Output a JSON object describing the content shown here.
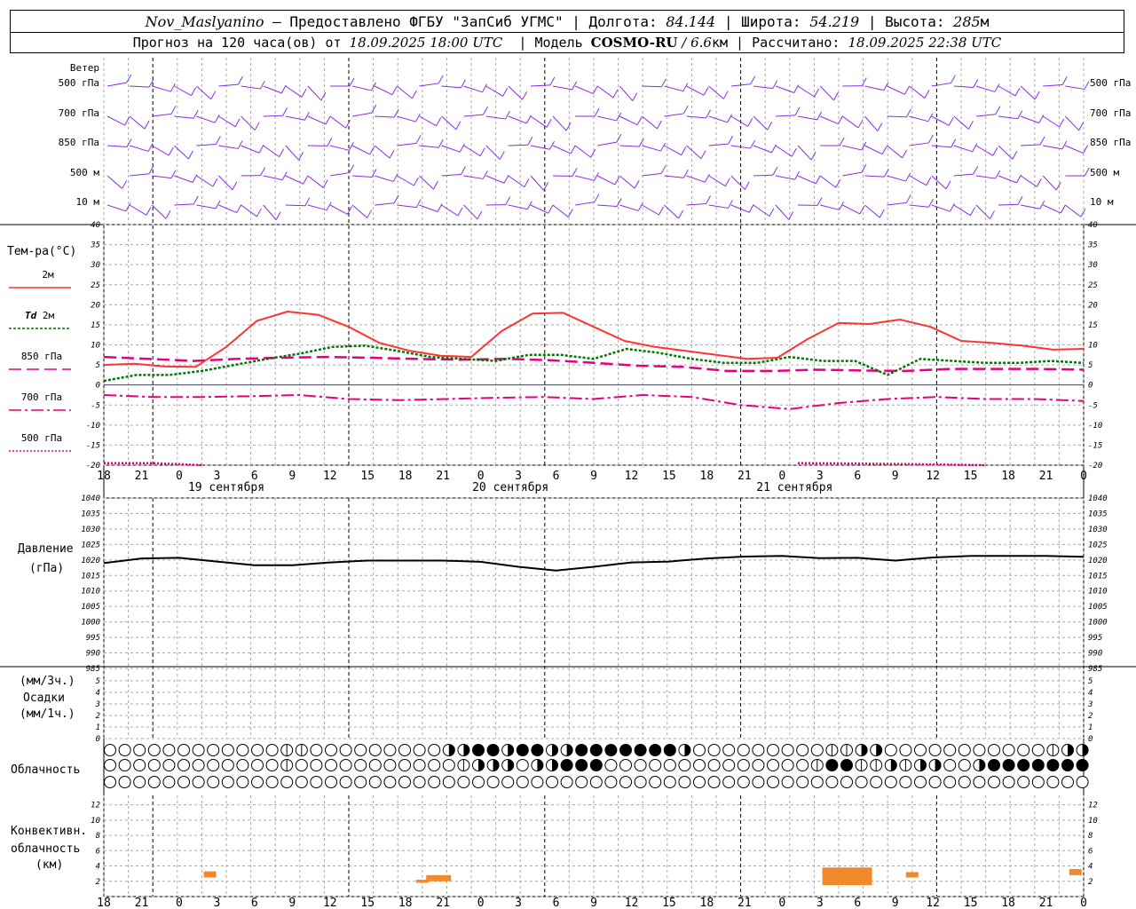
{
  "header": {
    "station": "Nov_Maslyanino",
    "provider": " – Предоставлено ФГБУ \"ЗапСиб УГМС\" | Долгота: ",
    "lon": "84.144",
    "lat_label": " | Широта: ",
    "lat": "54.219",
    "alt_label": " | Высота: ",
    "alt": "285",
    "alt_unit": "м",
    "forecast_label": "Прогноз на 120 часа(ов) от ",
    "forecast_start": "18.09.2025 18:00 UTC",
    "model_label": "  | Модель ",
    "model": "COSMO-RU",
    "model_res": " / 6.6",
    "model_res_unit": "км",
    "calc_label": " | Рассчитано: ",
    "calc_time": "18.09.2025 22:38 UTC"
  },
  "x_axis": {
    "tick_labels": [
      "18",
      "21",
      "0",
      "3",
      "6",
      "9",
      "12",
      "15",
      "18",
      "21",
      "0",
      "3",
      "6",
      "9",
      "12",
      "15",
      "18",
      "21",
      "0",
      "3",
      "6",
      "9",
      "12",
      "15",
      "18",
      "21",
      "0"
    ],
    "day_labels": [
      "19 сентября",
      "20 сентября",
      "21 сентября"
    ]
  },
  "wind_panel": {
    "title": "Ветер",
    "levels": [
      "500 гПа",
      "700 гПа",
      "850 гПа",
      "500 м",
      "10  м"
    ]
  },
  "temp_panel": {
    "title": "Тем-ра(°C)",
    "legend": [
      {
        "label": "2м",
        "color": "#ff3333",
        "style": "solid"
      },
      {
        "label_it": "Td",
        "label": "2м",
        "color": "#007700",
        "style": "dotted"
      },
      {
        "label": "850 гПа",
        "color": "#e6007e",
        "style": "dashed"
      },
      {
        "label": "700 гПа",
        "color": "#e6007e",
        "style": "dashdot"
      },
      {
        "label": "500 гПа",
        "color": "#e6007e",
        "style": "dotted"
      }
    ],
    "y_ticks": [
      "40",
      "35",
      "30",
      "25",
      "20",
      "15",
      "10",
      "5",
      "0",
      "-5",
      "-10",
      "-15",
      "-20"
    ]
  },
  "pressure_panel": {
    "title1": "Давление",
    "title2": "(гПа)",
    "y_ticks": [
      "1040",
      "1035",
      "1030",
      "1025",
      "1020",
      "1015",
      "1010",
      "1005",
      "1000",
      "995",
      "990",
      "985"
    ]
  },
  "precip_panel": {
    "title1": "(мм/3ч.)",
    "title2": "Осадки",
    "title3": "(мм/1ч.)",
    "y_ticks": [
      "5",
      "4",
      "3",
      "2",
      "1",
      "0"
    ]
  },
  "cloud_panel": {
    "title": "Облачность"
  },
  "conv_panel": {
    "title1": "Конвективн.",
    "title2": "облачность",
    "title3": "(км)",
    "y_ticks": [
      "12",
      "10",
      "8",
      "6",
      "4",
      "2"
    ]
  },
  "chart_data": {
    "type": "line",
    "x_hours_from_start": [
      0,
      3,
      6,
      9,
      12,
      15,
      18,
      21,
      24,
      27,
      30,
      33,
      36,
      39,
      42,
      45,
      48,
      51,
      54,
      57,
      60,
      63,
      66,
      69,
      72,
      75,
      78,
      81,
      84,
      87,
      90,
      93,
      96,
      99,
      102,
      105,
      108,
      111,
      114,
      117,
      120
    ],
    "series": [
      {
        "name": "2м",
        "color": "#ff3333",
        "values": [
          5,
          5.3,
          4.6,
          4.5,
          9.5,
          16,
          18.3,
          17.5,
          14.5,
          10.5,
          8.5,
          7.3,
          7,
          13.5,
          17.8,
          18,
          14.5,
          11,
          9.5,
          8.5,
          7.5,
          6.5,
          6.8,
          11.5,
          15.5,
          15.2,
          16.3,
          14.5,
          11,
          10.5,
          9.8,
          8.8,
          9
        ]
      },
      {
        "name": "Td 2м",
        "color": "#007700",
        "values": [
          1,
          2.5,
          2.5,
          3.5,
          5,
          6.5,
          7.8,
          9.5,
          9.8,
          8.5,
          7,
          6.5,
          6,
          7.5,
          7.5,
          6.5,
          9,
          8,
          6.5,
          5.5,
          5.5,
          7,
          6,
          6,
          2.5,
          6.5,
          6,
          5.5,
          5.5,
          6,
          5.5
        ]
      },
      {
        "name": "850 гПа",
        "color": "#e6007e",
        "values": [
          7,
          6.5,
          6,
          6.5,
          6.8,
          7,
          6.8,
          6.5,
          6.3,
          6.5,
          6.2,
          5.5,
          4.8,
          4.5,
          3.5,
          3.5,
          3.8,
          3.6,
          3.5,
          4,
          4,
          4,
          3.8
        ]
      },
      {
        "name": "700 гПа",
        "color": "#e6007e",
        "values": [
          -2.5,
          -3,
          -3,
          -2.8,
          -2.5,
          -3.5,
          -3.8,
          -3.5,
          -3.2,
          -3,
          -3.5,
          -2.5,
          -3,
          -5,
          -6,
          -4.5,
          -3.5,
          -3,
          -3.5,
          -3.5,
          -4
        ]
      },
      {
        "name": "500 гПа",
        "color": "#e6007e",
        "values": [
          -19.5,
          -19.5,
          -20
        ]
      },
      {
        "name": "Давление",
        "color": "#000000",
        "values": [
          1019,
          1020.5,
          1020.7,
          1019.5,
          1018.3,
          1018.3,
          1019.2,
          1019.8,
          1019.8,
          1019.8,
          1019.4,
          1017.8,
          1016.6,
          1017.8,
          1019.2,
          1019.5,
          1020.5,
          1021.1,
          1021.3,
          1020.6,
          1020.7,
          1019.8,
          1020.8,
          1021.3,
          1021.3,
          1021.3,
          1021.0
        ]
      }
    ],
    "convective_cloud_km": [
      {
        "hour": 13,
        "base": 2.5,
        "top": 3.3
      },
      {
        "hour": 39,
        "base": 1.8,
        "top": 2.2
      },
      {
        "hour": 41,
        "base": 2,
        "top": 2.8
      },
      {
        "hour": 88,
        "base": 1.5,
        "top": 3.8
      },
      {
        "hour": 99,
        "base": 2.5,
        "top": 3.2
      },
      {
        "hour": 119,
        "base": 2.8,
        "top": 3.6
      }
    ],
    "precip_mm": 0,
    "temp_ylim": [
      -20,
      40
    ],
    "pressure_ylim": [
      985,
      1040
    ],
    "conv_ylim": [
      0,
      13
    ]
  }
}
